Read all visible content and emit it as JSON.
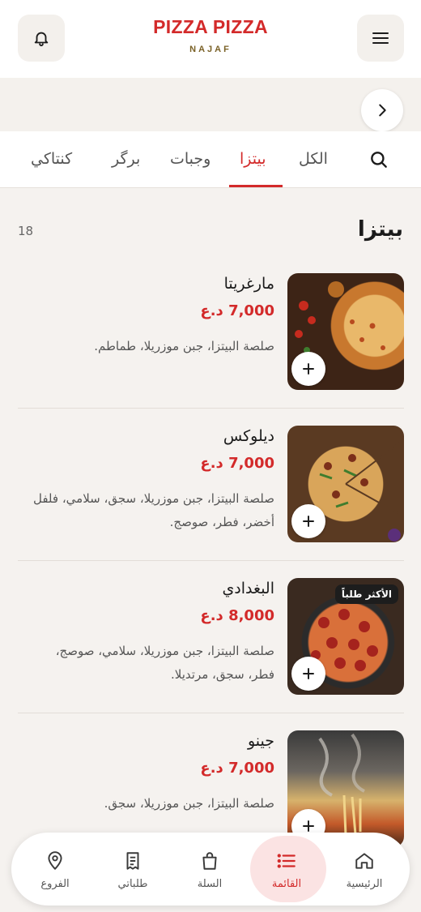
{
  "header": {
    "brand_name": "PIZZA PIZZA",
    "brand_sub": "NAJAF",
    "bell_icon": "bell-icon",
    "menu_icon": "hamburger-icon"
  },
  "banner": {
    "next_icon": "chevron-right-icon"
  },
  "tabs": {
    "items": [
      {
        "label": "الكل"
      },
      {
        "label": "بيتزا"
      },
      {
        "label": "وجبات"
      },
      {
        "label": "برگر"
      },
      {
        "label": "كنتاكي"
      }
    ],
    "active": "بيتزا",
    "search_icon": "search-icon"
  },
  "section": {
    "title": "بيتزا",
    "count": "18"
  },
  "items": [
    {
      "name": "مارغريتا",
      "price": "7,000 د.ع",
      "desc": "صلصة البيتزا، جبن موزريلا، طماطم.",
      "badge": ""
    },
    {
      "name": "ديلوكس",
      "price": "7,000 د.ع",
      "desc": "صلصة البيتزا، جبن موزريلا، سجق، سلامي، فلفل أخضر، فطر، صوصج.",
      "badge": ""
    },
    {
      "name": "البغدادي",
      "price": "8,000 د.ع",
      "desc": "صلصة البيتزا، جبن موزريلا، سلامي، صوصج، فطر، سجق، مرتديلا.",
      "badge": "الأكثر طلباً"
    },
    {
      "name": "جينو",
      "price": "7,000 د.ع",
      "desc": "صلصة البيتزا، جبن موزريلا، سجق.",
      "badge": ""
    }
  ],
  "bottom_nav": {
    "home": "الرئيسية",
    "menu": "القائمة",
    "cart": "السلة",
    "orders": "طلباتي",
    "branches": "الفروع",
    "active": "القائمة"
  },
  "colors": {
    "accent": "#d32a2a",
    "background": "#f5f2ef",
    "gold": "#7a6127"
  }
}
